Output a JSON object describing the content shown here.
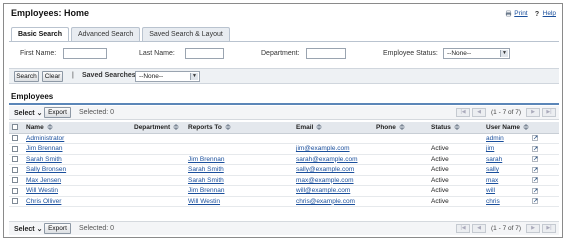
{
  "header": {
    "title": "Employees: Home",
    "print_label": "Print",
    "help_label": "Help"
  },
  "tabs": [
    {
      "label": "Basic Search",
      "active": true
    },
    {
      "label": "Advanced Search",
      "active": false
    },
    {
      "label": "Saved Search & Layout",
      "active": false
    }
  ],
  "search": {
    "first_name_label": "First Name:",
    "first_name_value": "",
    "last_name_label": "Last Name:",
    "last_name_value": "",
    "department_label": "Department:",
    "department_value": "",
    "status_label": "Employee Status:",
    "status_value": "--None--"
  },
  "buttons": {
    "search": "Search",
    "clear": "Clear",
    "separator": "|",
    "saved_searches_label": "Saved Searches",
    "saved_searches_value": "--None--"
  },
  "section": {
    "title": "Employees"
  },
  "toolbar": {
    "select_label": "Select",
    "export_label": "Export",
    "selected_text": "Selected:  0",
    "range_text": "(1 - 7 of 7)"
  },
  "columns": [
    "Name",
    "Department",
    "Reports To",
    "Email",
    "Phone",
    "Status",
    "User Name"
  ],
  "rows": [
    {
      "name": "Administrator",
      "department": "",
      "reports_to": "",
      "email": "",
      "phone": "",
      "status": "",
      "user_name": "admin"
    },
    {
      "name": "Jim Brennan",
      "department": "",
      "reports_to": "",
      "email": "jim@example.com",
      "phone": "",
      "status": "Active",
      "user_name": "jim"
    },
    {
      "name": "Sarah Smith",
      "department": "",
      "reports_to": "Jim Brennan",
      "email": "sarah@example.com",
      "phone": "",
      "status": "Active",
      "user_name": "sarah"
    },
    {
      "name": "Sally Bronsen",
      "department": "",
      "reports_to": "Sarah Smith",
      "email": "sally@example.com",
      "phone": "",
      "status": "Active",
      "user_name": "sally"
    },
    {
      "name": "Max Jensen",
      "department": "",
      "reports_to": "Sarah Smith",
      "email": "max@example.com",
      "phone": "",
      "status": "Active",
      "user_name": "max"
    },
    {
      "name": "Will Westin",
      "department": "",
      "reports_to": "Jim Brennan",
      "email": "will@example.com",
      "phone": "",
      "status": "Active",
      "user_name": "will"
    },
    {
      "name": "Chris Olliver",
      "department": "",
      "reports_to": "Will Westin",
      "email": "chris@example.com",
      "phone": "",
      "status": "Active",
      "user_name": "chris"
    }
  ],
  "colors": {
    "link": "#1a4f9c",
    "accent": "#5b86b8"
  },
  "icons": {
    "print": "printer-icon",
    "help": "help-icon",
    "sort": "sort-arrows-icon",
    "row_action": "open-record-icon"
  }
}
